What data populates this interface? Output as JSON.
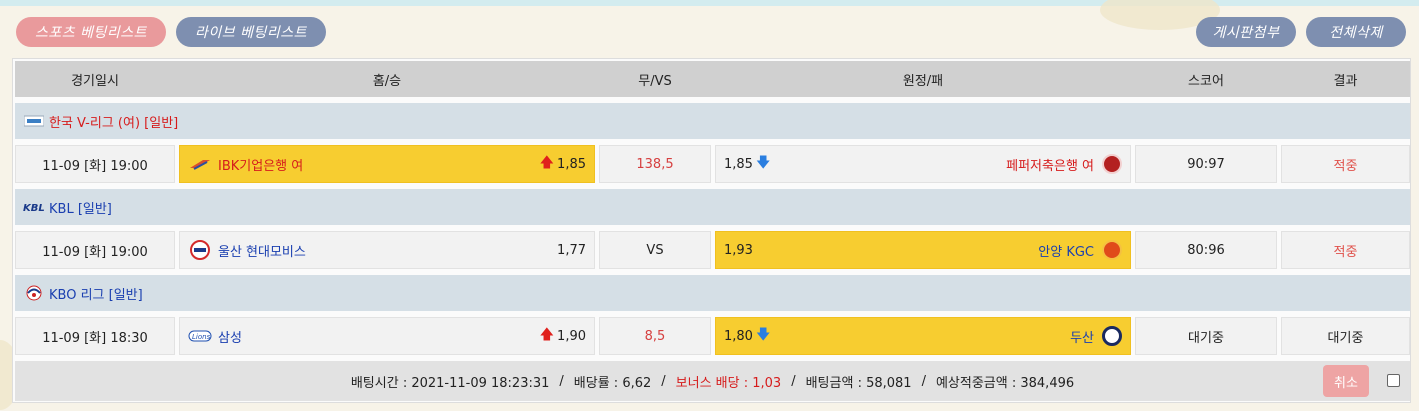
{
  "tabs": {
    "sports": "스포츠 베팅리스트",
    "live": "라이브 베팅리스트",
    "board": "게시판첨부",
    "delete_all": "전체삭제"
  },
  "headers": {
    "datetime": "경기일시",
    "home": "홈/승",
    "draw": "무/VS",
    "away": "원정/패",
    "score": "스코어",
    "result": "결과"
  },
  "games": [
    {
      "league": "한국 V-리그 (여) [일반]",
      "league_icon": "kovo-logo-icon",
      "datetime": "11-09 [화] 19:00",
      "home_team": "IBK기업은행 여",
      "home_odds": "1,85",
      "home_trend": "up",
      "draw": "138,5",
      "away_odds": "1,85",
      "away_trend": "down",
      "away_team": "페퍼저축은행 여",
      "score": "90:97",
      "result": "적중",
      "selected": "home"
    },
    {
      "league": "KBL [일반]",
      "league_icon": "kbl-logo-icon",
      "datetime": "11-09 [화] 19:00",
      "home_team": "울산 현대모비스",
      "home_odds": "1,77",
      "home_trend": "",
      "draw": "VS",
      "away_odds": "1,93",
      "away_trend": "",
      "away_team": "안양 KGC",
      "score": "80:96",
      "result": "적중",
      "selected": "away"
    },
    {
      "league": "KBO 리그 [일반]",
      "league_icon": "kbo-logo-icon",
      "datetime": "11-09 [화] 18:30",
      "home_team": "삼성",
      "home_odds": "1,90",
      "home_trend": "up",
      "draw": "8,5",
      "away_odds": "1,80",
      "away_trend": "down",
      "away_team": "두산",
      "score": "대기중",
      "result": "대기중",
      "selected": "away"
    }
  ],
  "summary": {
    "bet_time": "배팅시간 : 2021-11-09 18:23:31",
    "sep": "/",
    "odds": "배당률 : 6,62",
    "bonus": "보너스 배당 : 1,03",
    "bet_amount": "배팅금액 : 58,081",
    "expected": "예상적중금액 : 384,496",
    "cancel": "취소"
  },
  "colors": {
    "selected_bg": "#f7cd30",
    "league_bg": "#d5dfe6",
    "header_bg": "#d0d0d0",
    "pill_pink": "#e99a9c",
    "pill_blue": "#7e8fb0",
    "win": "#e0504a",
    "up_arrow": "#e0201c",
    "down_arrow": "#2a7ee0"
  }
}
